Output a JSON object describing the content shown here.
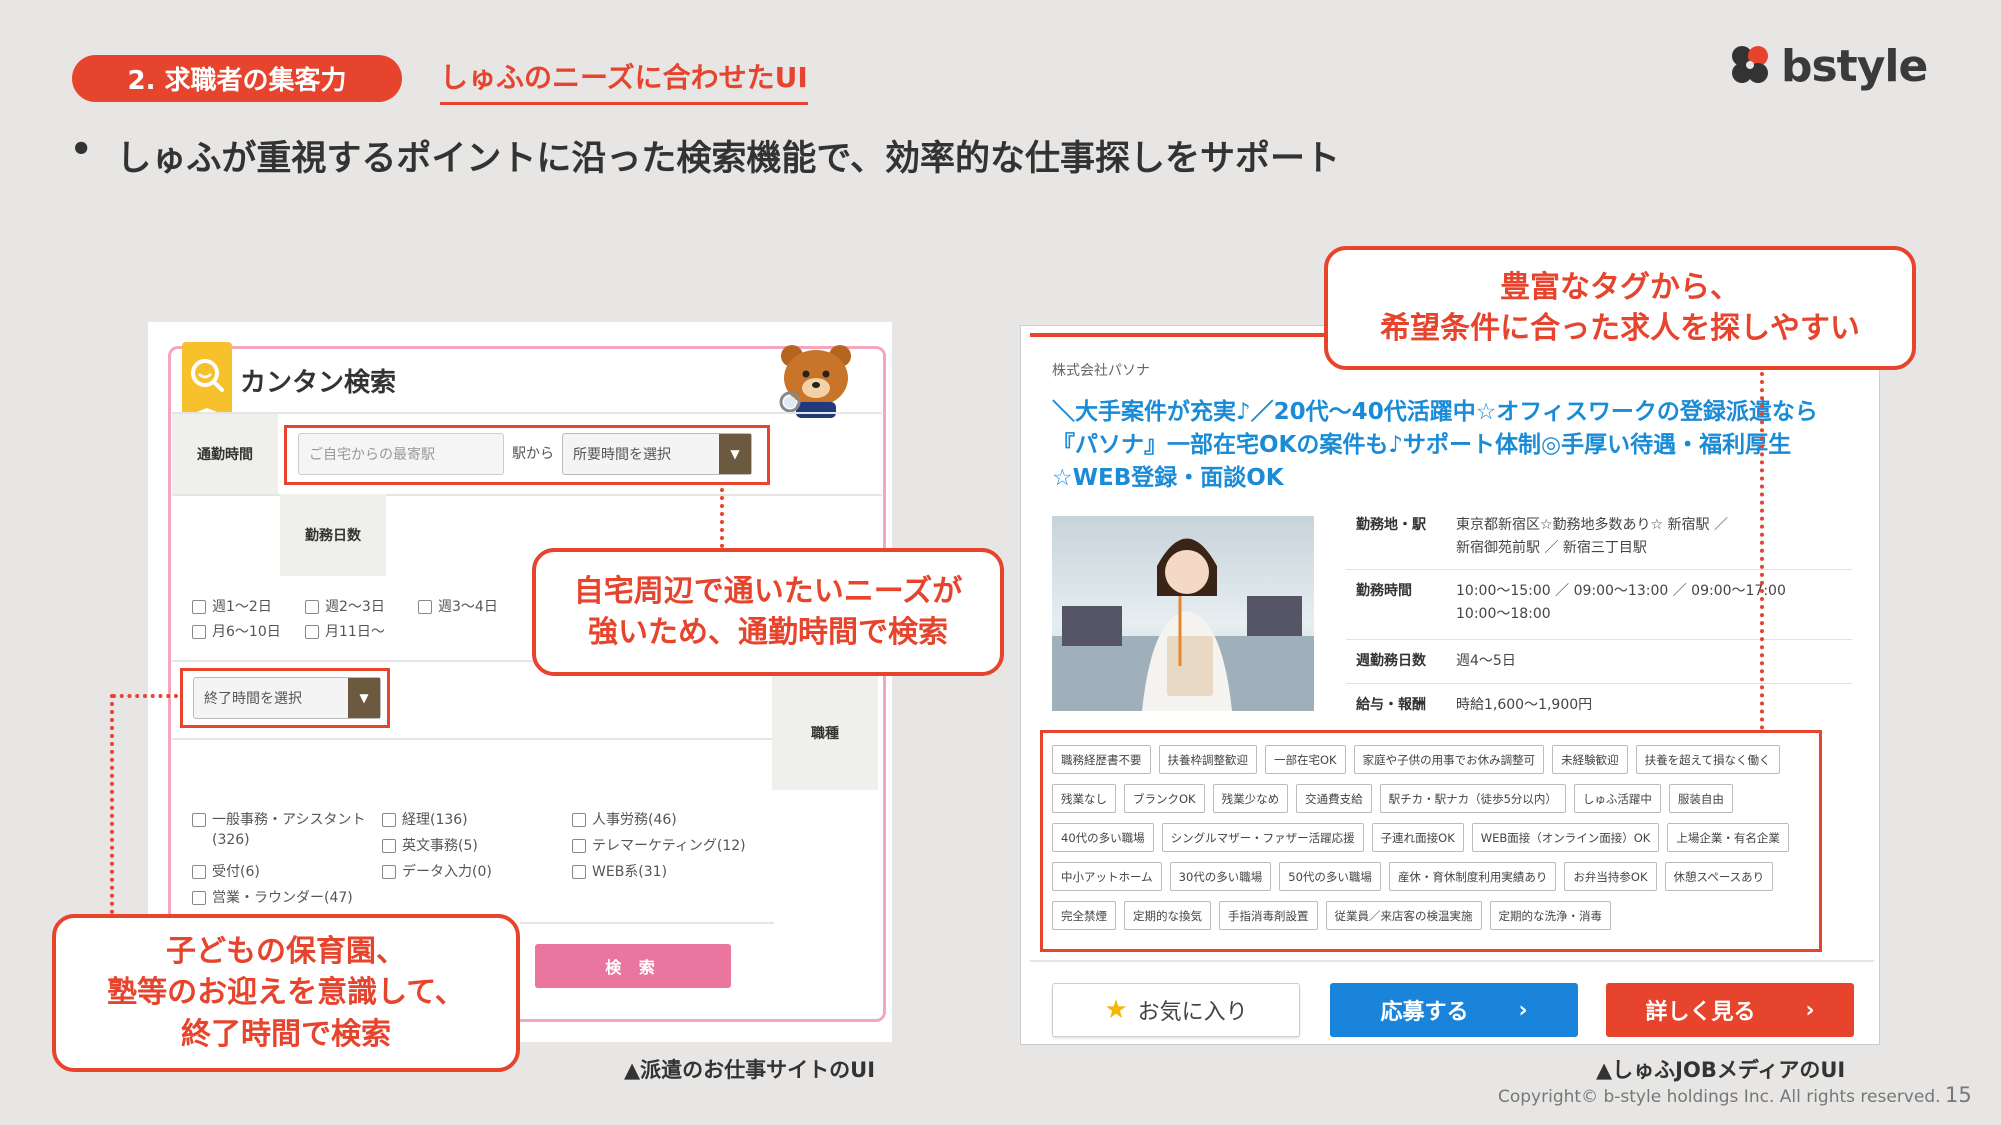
{
  "header": {
    "section_pill": "2. 求職者の集客力",
    "section_sub": "しゅふのニーズに合わせたUI",
    "logo_text": "bstyle",
    "bullet_mark": "•",
    "bullet_text": "しゅふが重視するポイントに沿った検索機能で、効率的な仕事探しをサポート"
  },
  "left_panel": {
    "title": "カンタン検索",
    "commute_label": "通勤時間",
    "station_placeholder": "ご自宅からの最寄駅",
    "from_text": "駅から",
    "time_select": "所要時間を選択",
    "days_label": "勤務日数",
    "day_options": [
      "週1〜2日",
      "週2〜3日",
      "週3〜4日",
      "月6〜10日",
      "月11日〜"
    ],
    "end_time_select": "終了時間を選択",
    "job_type_label": "職種",
    "job_options": [
      "一般事務・アシスタント(326)",
      "経理(136)",
      "人事労務(46)",
      "英文事務(5)",
      "テレマーケティング(12)",
      "受付(6)",
      "データ入力(0)",
      "WEB系(31)",
      "営業・ラウンダー(47)"
    ],
    "search_button": "検 索",
    "caption": "▲派遣のお仕事サイトのUI"
  },
  "callouts": {
    "commute_line1": "自宅周辺で通いたいニーズが",
    "commute_line2": "強いため、通勤時間で検索",
    "endtime_line1": "子どもの保育園、",
    "endtime_line2": "塾等のお迎えを意識して、",
    "endtime_line3": "終了時間で検索",
    "tags_line1": "豊富なタグから、",
    "tags_line2": "希望条件に合った求人を探しやすい"
  },
  "right_panel": {
    "company": "株式会社パソナ",
    "job_title": "＼大手案件が充実♪／20代〜40代活躍中☆オフィスワークの登録派遣なら『パソナ』一部在宅OKの案件も♪サポート体制◎手厚い待遇・福利厚生☆WEB登録・面談OK",
    "info": [
      {
        "key": "勤務地・駅",
        "value": "東京都新宿区☆勤務地多数あり☆ 新宿駅 ／ 新宿御苑前駅 ／ 新宿三丁目駅"
      },
      {
        "key": "勤務時間",
        "value": "10:00〜15:00 ／ 09:00〜13:00 ／ 09:00〜17:00 10:00〜18:00"
      },
      {
        "key": "週勤務日数",
        "value": "週4〜5日"
      },
      {
        "key": "給与・報酬",
        "value": "時給1,600〜1,900円"
      }
    ],
    "tags": [
      "職務経歴書不要",
      "扶養枠調整歓迎",
      "一部在宅OK",
      "家庭や子供の用事でお休み調整可",
      "未経験歓迎",
      "扶養を超えて損なく働く",
      "残業なし",
      "ブランクOK",
      "残業少なめ",
      "交通費支給",
      "駅チカ・駅ナカ（徒歩5分以内）",
      "しゅふ活躍中",
      "服装自由",
      "40代の多い職場",
      "シングルマザー・ファザー活躍応援",
      "子連れ面接OK",
      "WEB面接（オンライン面接）OK",
      "上場企業・有名企業",
      "中小アットホーム",
      "30代の多い職場",
      "50代の多い職場",
      "産休・育休制度利用実績あり",
      "お弁当持参OK",
      "休憩スペースあり",
      "完全禁煙",
      "定期的な換気",
      "手指消毒剤設置",
      "従業員／来店客の検温実施",
      "定期的な洗浄・消毒"
    ],
    "fav_button": "お気に入り",
    "apply_button": "応募する",
    "detail_button": "詳しく見る",
    "caption": "▲しゅふJOBメディアのUI"
  },
  "footer": {
    "copyright": "Copyright© b-style holdings Inc. All rights reserved.",
    "page_number": "15"
  },
  "colors": {
    "accent": "#e6442d",
    "pink": "#ea76a0",
    "blue": "#1a84db",
    "title_blue": "#1a8bd6"
  }
}
